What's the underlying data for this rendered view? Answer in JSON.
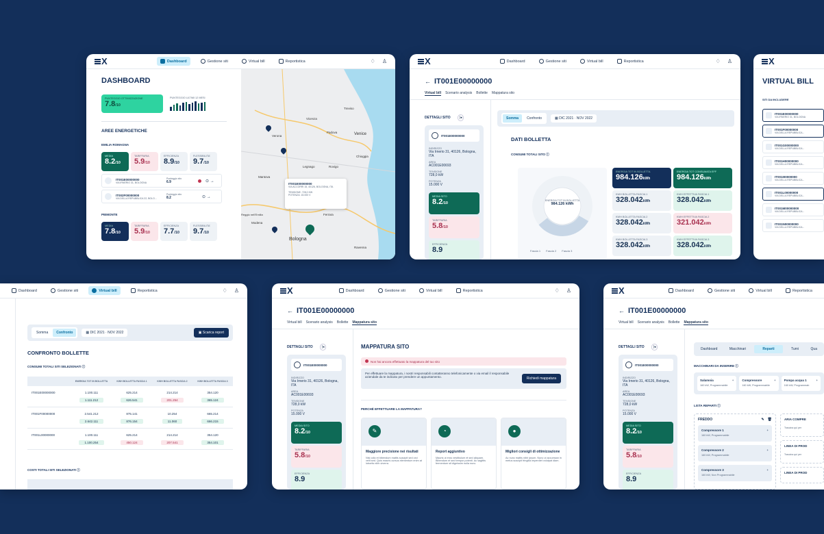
{
  "nav": {
    "dashboard": "Dashboard",
    "gestione": "Gestione siti",
    "virtual": "Virtual bill",
    "report": "Reportistica"
  },
  "logo": "X",
  "c1": {
    "title": "DASHBOARD",
    "score_label": "PUNTEGGIO OTTIMIZZAZIONE",
    "score": "7.8",
    "slash": "/10",
    "trend_label": "PUNTEGGIO ULTIMI 12 MESI",
    "areas": "AREE ENERGETICHE",
    "region1": "EMILIA ROMAGNA",
    "region2": "PIEMONTE",
    "tiles1": [
      {
        "l": "MEDIA",
        "v": "8.2"
      },
      {
        "l": "TARIFFARIA",
        "v": "5.9"
      },
      {
        "l": "EFFICIENZA",
        "v": "8.9"
      },
      {
        "l": "FLESSIBILITA'",
        "v": "9.7"
      }
    ],
    "tiles2": [
      {
        "l": "MEDIA",
        "v": "7.8"
      },
      {
        "l": "TARIFFARIA",
        "v": "5.9"
      },
      {
        "l": "EFFICIENZA",
        "v": "7.7"
      },
      {
        "l": "FLESSIBILITA'",
        "v": "9.7"
      }
    ],
    "sites": [
      {
        "id": "IT001E00000000",
        "addr": "VIA IRNERIO 31, BOLOGNA",
        "pl": "Punteggio sito",
        "v": "6.9"
      },
      {
        "id": "IT002F00000000",
        "addr": "VIA DELLA REPUBBLICA 22, BOLO...",
        "pl": "Punteggio sito",
        "v": "8.2"
      }
    ],
    "map": {
      "popup_id": "IT001E00000000",
      "popup_addr": "VIA ACCORRI 15, 40126, BOLOGNA, ITA",
      "popup_t": "TENSIONE: 728,0 KW",
      "popup_p": "POTENZA: 15.000 V",
      "c1": "Padova",
      "c2": "Venice",
      "c3": "Bologna",
      "c4": "Modena",
      "c5": "Ferrara",
      "c6": "Verona",
      "c7": "Vicenza",
      "c8": "Treviso",
      "c9": "Rovigo",
      "c10": "Chioggia",
      "c11": "Mantova",
      "c12": "Legnago",
      "c13": "Ravenna",
      "c14": "Reggio nell'Emilia"
    }
  },
  "site": {
    "back": "←",
    "id": "IT001E00000000",
    "tabs": [
      "Virtual bill",
      "Scenario analysis",
      "Bollette",
      "Mappatura sito"
    ],
    "dett": "DETTAGLI SITO",
    "sid": "IT001E00000000",
    "ind_l": "INDIRIZZO",
    "ind": "Via Irnerio 31, 40126, Bologna, ITA",
    "area_l": "AREA",
    "area": "AC001E00693",
    "ten_l": "TENSIONE",
    "ten": "728,0 kW",
    "pot_l": "POTENZA",
    "pot": "15.000 V",
    "media_l": "MEDIA SITO",
    "media": "8.2",
    "tar_l": "TARIFFARIA",
    "tar": "5.8",
    "eff_l": "EFFICIENZA",
    "eff": "8.9"
  },
  "c2": {
    "somma": "Somma",
    "confronto": "Confronto",
    "period": "DIC 2021 · NOV 2022",
    "dati": "DATI BOLLETTA",
    "consumi": "CONSUMI TOTALI SITO",
    "donut_l": "ENERGIA TOT IN BOLLETTA",
    "donut_v": "984.126 kWh",
    "legend": [
      "Fascia 1",
      "Fascia 2",
      "Fascia 3"
    ],
    "stats": [
      {
        "l": "ENERGIA TOT IN BOLLETTA",
        "v": "984.126"
      },
      {
        "l": "ENERGIA TOT CONSUMATA EFF",
        "v": "984.126"
      },
      {
        "l": "KWH BOLLETTA FASCIA 1",
        "v": "328.042"
      },
      {
        "l": "KWH EFFETTIVA FASCIA 1",
        "v": "328.042"
      },
      {
        "l": "KWH BOLLETTA FASCIA 2",
        "v": "328.042"
      },
      {
        "l": "KWH EFFETTIVA FASCIA 2",
        "v": "321.042"
      },
      {
        "l": "KWH BOLLETTA FASCIA 3",
        "v": "328.042"
      },
      {
        "l": "KWH EFFETTIVA FASCIA 3",
        "v": "328.042"
      }
    ],
    "unit": "kWh"
  },
  "c3": {
    "title": "VIRTUAL BILL",
    "siti": "SITI DA INCLUDERE",
    "list": [
      {
        "id": "IT001E00000000",
        "a": "VIA IRNERIO 31, BOLOGNA"
      },
      {
        "id": "IT001F00000000",
        "a": "VIA DELLA REPUBBLICA..."
      },
      {
        "id": "IT001G00000000",
        "a": "VIA DELLA REPUBBLICA..."
      },
      {
        "id": "IT001H00000000",
        "a": "VIA DELLA REPUBBLICA..."
      },
      {
        "id": "IT001I00000000",
        "a": "VIA DELLA REPUBBLICA..."
      },
      {
        "id": "IT001L00000000",
        "a": "VIA DELLA REPUBBLICA..."
      },
      {
        "id": "IT001M00000000",
        "a": "VIA DELLA REPUBBLICA..."
      },
      {
        "id": "IT001N00000000",
        "a": "VIA DELLA REPUBBLICA..."
      }
    ]
  },
  "c4": {
    "somma": "Somma",
    "confronto": "Confronto",
    "period": "DIC 2021 · NOV 2022",
    "scarica": "Scarica report",
    "title": "CONFRONTO BOLLETTE",
    "consumi": "CONSUMI TOTALI SITI SELEZIONATI",
    "costi": "COSTI TOTALI SITI SELEZIONATI",
    "cols": [
      "ENERGIA TOT IN BOLLETTA",
      "KWH BOLLETTA FASCIA 1",
      "KWH BOLLETTA FASCIA 2",
      "KWH BOLLETTA FASCIA 3"
    ],
    "rows": [
      {
        "id": "IT001E00000000",
        "a": [
          "1.100.111",
          "625.214",
          "214.214",
          "354.120"
        ],
        "b": [
          "1.111.212",
          "626.541",
          "201.254",
          "365.124"
        ]
      },
      {
        "id": "IT001F00000000",
        "a": [
          "2.541.212",
          "875.141",
          "10.254",
          "665.214"
        ],
        "b": [
          "2.642.111",
          "876.154",
          "11.060",
          "666.215"
        ]
      },
      {
        "id": "IT001L00000000",
        "a": [
          "1.100.111",
          "625.214",
          "214.214",
          "354.120"
        ],
        "b": [
          "1.100.254",
          "450.124",
          "207.541",
          "354.101"
        ]
      }
    ]
  },
  "c5": {
    "title": "MAPPATURA SITO",
    "warn": "Non hai ancora effettuato la mappatura del tuo sito",
    "info": "Per effettuare la mappatura, i nostri responsabili contatteranno telefonicamente o via email il responsabile aziendale da te indicato per prendere un appuntamento.",
    "richiedi": "Richiedi mappatura",
    "perche": "PERCHÉ EFFETTUARE LA MAPPATURA?",
    "cards": [
      {
        "t": "Maggiore precisione nei risultati",
        "d": "Nisi odio et bibendum mattis suscipit sed orci velit sed. Quis mauris cursus elementum enim at lobortis nibh viverra."
      },
      {
        "t": "Report aggiuntivo",
        "d": "Mauris ut eros vestibulum et sed aliquam. Bibendum et sed tempor potenti. Ac sagittis fermentum sit dignissim nulla nunc."
      },
      {
        "t": "Migliori consigli di ottimizzazione",
        "d": "Ac nunc mattis nibh ipsum. Nunc ut accumsan in metus suscipit fringilla imperdiet volutpat diam."
      }
    ]
  },
  "c6": {
    "tabs": [
      "Dashboard",
      "Macchinari",
      "Reparti",
      "Turni",
      "Qua"
    ],
    "macch": "MACCHINARI DA INSERIRE",
    "m": [
      {
        "t": "Salamoia",
        "d": "160 kW, Programmabile"
      },
      {
        "t": "Compressore",
        "d": "160 kW, Programmabile"
      },
      {
        "t": "Pompa acqua 1",
        "d": "160 kW, Programmab"
      }
    ],
    "lista": "LISTA REPARTI",
    "freddo": "FREDDO",
    "items": [
      {
        "t": "Compressore 1",
        "d": "160 kW, Programmabile"
      },
      {
        "t": "Compressore 2",
        "d": "160 kW, Programmabile"
      },
      {
        "t": "Compressore 3",
        "d": "160 kW, Non Programmabile"
      }
    ],
    "right": [
      "ARIA COMPRE",
      "LINEA DI PROD",
      "LINEA DI PROD"
    ],
    "trascina": "Trascina qui per"
  }
}
